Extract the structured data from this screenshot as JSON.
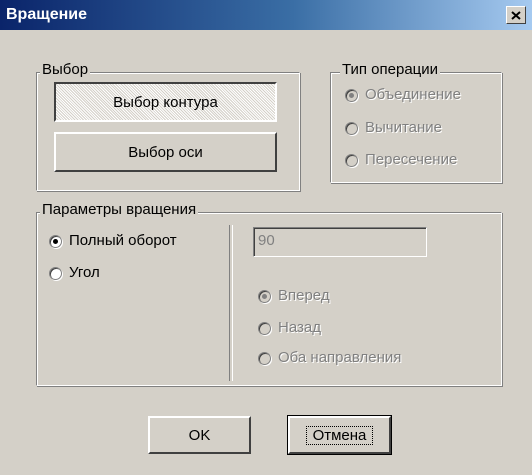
{
  "window": {
    "title": "Вращение",
    "close_icon": "close-icon"
  },
  "selection": {
    "legend": "Выбор",
    "contour_button": "Выбор контура",
    "axis_button": "Выбор оси"
  },
  "operation": {
    "legend": "Тип операции",
    "options": [
      "Объединение",
      "Вычитание",
      "Пересечение"
    ],
    "selected": "Объединение"
  },
  "rotation": {
    "legend": "Параметры вращения",
    "mode_options": [
      "Полный оборот",
      "Угол"
    ],
    "mode_selected": "Полный оборот",
    "angle_value": "90",
    "direction_options": [
      "Вперед",
      "Назад",
      "Оба направления"
    ],
    "direction_selected": "Вперед"
  },
  "footer": {
    "ok": "OK",
    "cancel": "Отмена"
  }
}
